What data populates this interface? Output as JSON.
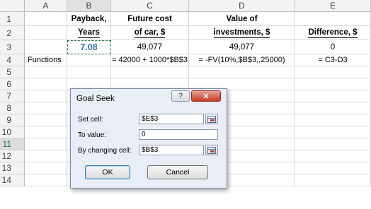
{
  "columns": [
    "A",
    "B",
    "C",
    "D",
    "E"
  ],
  "rows": [
    "1",
    "2",
    "3",
    "4",
    "5",
    "6",
    "7",
    "8",
    "9",
    "10",
    "11",
    "12",
    "13",
    "14"
  ],
  "cells": {
    "B1": "Payback,",
    "B2": "Years",
    "C1": "Future cost",
    "C2": "of car, $",
    "D1": "Value of",
    "D2": "investments, $",
    "E2": "Difference, $",
    "B3": "7.08",
    "C3": "49,077",
    "D3": "49,077",
    "E3": "0",
    "A4": "Functions",
    "C4": "= 42000 + 1000*$B$3",
    "D4": "= -FV(10%,$B$3,,25000)",
    "E4": "= C3-D3"
  },
  "dialog": {
    "title": "Goal Seek",
    "help_glyph": "?",
    "close_glyph": "✕",
    "set_cell_label": "Set cell:",
    "set_cell_value": "$E$3",
    "to_value_label": "To value:",
    "to_value_value": "0",
    "changing_cell_label": "By changing cell:",
    "changing_cell_value": "$B$3",
    "ok_label": "OK",
    "cancel_label": "Cancel"
  },
  "colors": {
    "accent_green": "#217346",
    "value_blue": "#2e75b6",
    "close_red": "#c53a25"
  }
}
